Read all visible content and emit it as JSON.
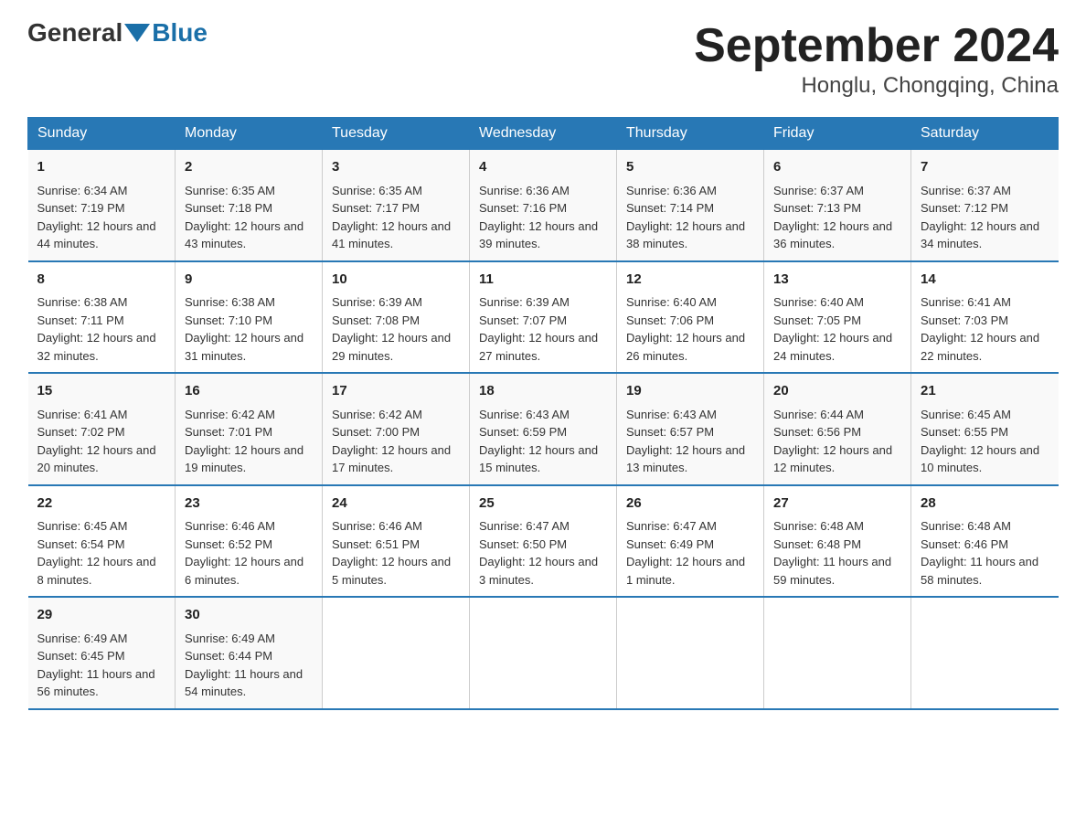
{
  "logo": {
    "general": "General",
    "blue": "Blue"
  },
  "title": "September 2024",
  "location": "Honglu, Chongqing, China",
  "headers": [
    "Sunday",
    "Monday",
    "Tuesday",
    "Wednesday",
    "Thursday",
    "Friday",
    "Saturday"
  ],
  "weeks": [
    [
      {
        "day": "1",
        "sunrise": "6:34 AM",
        "sunset": "7:19 PM",
        "daylight": "12 hours and 44 minutes."
      },
      {
        "day": "2",
        "sunrise": "6:35 AM",
        "sunset": "7:18 PM",
        "daylight": "12 hours and 43 minutes."
      },
      {
        "day": "3",
        "sunrise": "6:35 AM",
        "sunset": "7:17 PM",
        "daylight": "12 hours and 41 minutes."
      },
      {
        "day": "4",
        "sunrise": "6:36 AM",
        "sunset": "7:16 PM",
        "daylight": "12 hours and 39 minutes."
      },
      {
        "day": "5",
        "sunrise": "6:36 AM",
        "sunset": "7:14 PM",
        "daylight": "12 hours and 38 minutes."
      },
      {
        "day": "6",
        "sunrise": "6:37 AM",
        "sunset": "7:13 PM",
        "daylight": "12 hours and 36 minutes."
      },
      {
        "day": "7",
        "sunrise": "6:37 AM",
        "sunset": "7:12 PM",
        "daylight": "12 hours and 34 minutes."
      }
    ],
    [
      {
        "day": "8",
        "sunrise": "6:38 AM",
        "sunset": "7:11 PM",
        "daylight": "12 hours and 32 minutes."
      },
      {
        "day": "9",
        "sunrise": "6:38 AM",
        "sunset": "7:10 PM",
        "daylight": "12 hours and 31 minutes."
      },
      {
        "day": "10",
        "sunrise": "6:39 AM",
        "sunset": "7:08 PM",
        "daylight": "12 hours and 29 minutes."
      },
      {
        "day": "11",
        "sunrise": "6:39 AM",
        "sunset": "7:07 PM",
        "daylight": "12 hours and 27 minutes."
      },
      {
        "day": "12",
        "sunrise": "6:40 AM",
        "sunset": "7:06 PM",
        "daylight": "12 hours and 26 minutes."
      },
      {
        "day": "13",
        "sunrise": "6:40 AM",
        "sunset": "7:05 PM",
        "daylight": "12 hours and 24 minutes."
      },
      {
        "day": "14",
        "sunrise": "6:41 AM",
        "sunset": "7:03 PM",
        "daylight": "12 hours and 22 minutes."
      }
    ],
    [
      {
        "day": "15",
        "sunrise": "6:41 AM",
        "sunset": "7:02 PM",
        "daylight": "12 hours and 20 minutes."
      },
      {
        "day": "16",
        "sunrise": "6:42 AM",
        "sunset": "7:01 PM",
        "daylight": "12 hours and 19 minutes."
      },
      {
        "day": "17",
        "sunrise": "6:42 AM",
        "sunset": "7:00 PM",
        "daylight": "12 hours and 17 minutes."
      },
      {
        "day": "18",
        "sunrise": "6:43 AM",
        "sunset": "6:59 PM",
        "daylight": "12 hours and 15 minutes."
      },
      {
        "day": "19",
        "sunrise": "6:43 AM",
        "sunset": "6:57 PM",
        "daylight": "12 hours and 13 minutes."
      },
      {
        "day": "20",
        "sunrise": "6:44 AM",
        "sunset": "6:56 PM",
        "daylight": "12 hours and 12 minutes."
      },
      {
        "day": "21",
        "sunrise": "6:45 AM",
        "sunset": "6:55 PM",
        "daylight": "12 hours and 10 minutes."
      }
    ],
    [
      {
        "day": "22",
        "sunrise": "6:45 AM",
        "sunset": "6:54 PM",
        "daylight": "12 hours and 8 minutes."
      },
      {
        "day": "23",
        "sunrise": "6:46 AM",
        "sunset": "6:52 PM",
        "daylight": "12 hours and 6 minutes."
      },
      {
        "day": "24",
        "sunrise": "6:46 AM",
        "sunset": "6:51 PM",
        "daylight": "12 hours and 5 minutes."
      },
      {
        "day": "25",
        "sunrise": "6:47 AM",
        "sunset": "6:50 PM",
        "daylight": "12 hours and 3 minutes."
      },
      {
        "day": "26",
        "sunrise": "6:47 AM",
        "sunset": "6:49 PM",
        "daylight": "12 hours and 1 minute."
      },
      {
        "day": "27",
        "sunrise": "6:48 AM",
        "sunset": "6:48 PM",
        "daylight": "11 hours and 59 minutes."
      },
      {
        "day": "28",
        "sunrise": "6:48 AM",
        "sunset": "6:46 PM",
        "daylight": "11 hours and 58 minutes."
      }
    ],
    [
      {
        "day": "29",
        "sunrise": "6:49 AM",
        "sunset": "6:45 PM",
        "daylight": "11 hours and 56 minutes."
      },
      {
        "day": "30",
        "sunrise": "6:49 AM",
        "sunset": "6:44 PM",
        "daylight": "11 hours and 54 minutes."
      },
      null,
      null,
      null,
      null,
      null
    ]
  ]
}
